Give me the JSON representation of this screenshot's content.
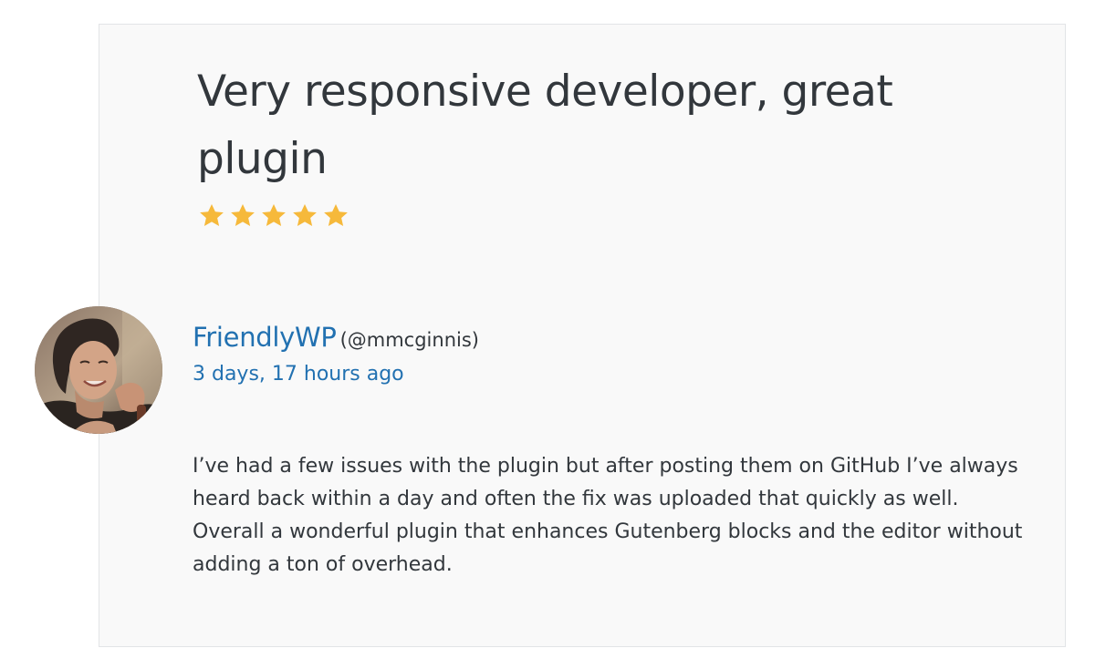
{
  "review": {
    "title": "Very responsive developer, great plugin",
    "rating": 5,
    "rating_max": 5,
    "star_color": "#f6b93b",
    "author": {
      "display_name": "FriendlyWP",
      "username": "(@mmcginnis)",
      "date": "3 days, 17 hours ago"
    },
    "body": "I’ve had a few issues with the plugin but after posting them on GitHub I’ve always heard back within a day and often the fix was uploaded that quickly as well. Overall a wonderful plugin that enhances Gutenberg blocks and the editor without adding a ton of overhead."
  },
  "colors": {
    "link": "#2271b1",
    "text": "#32373c",
    "card_background": "#f9f9f9"
  },
  "icons": {
    "rating": "star-icon"
  }
}
